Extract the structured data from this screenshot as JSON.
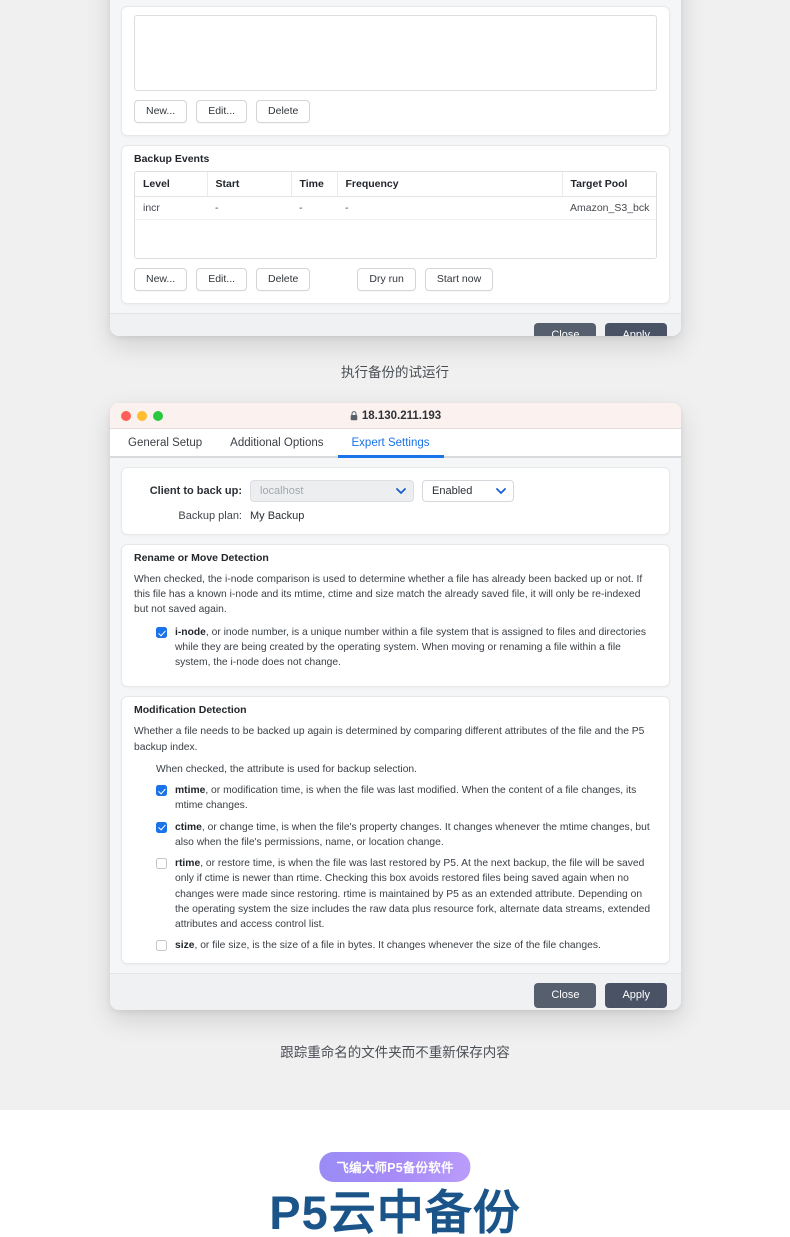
{
  "window1": {
    "top_list_buttons": [
      "New...",
      "Edit...",
      "Delete"
    ],
    "backup_events": {
      "section_title": "Backup Events",
      "columns": [
        "Level",
        "Start",
        "Time",
        "Frequency",
        "Target Pool"
      ],
      "rows": [
        {
          "level": "incr",
          "start": "-",
          "time": "-",
          "frequency": "-",
          "target_pool": "Amazon_S3_bck"
        }
      ],
      "buttons": [
        "New...",
        "Edit...",
        "Delete"
      ],
      "action_buttons": [
        "Dry run",
        "Start now"
      ]
    },
    "footer": {
      "close_label": "Close",
      "apply_label": "Apply"
    }
  },
  "caption1": "执行备份的试运行",
  "window2": {
    "titlebar": {
      "address": "18.130.211.193",
      "lock_icon": "lock-icon"
    },
    "tabs": [
      {
        "label": "General Setup",
        "active": false
      },
      {
        "label": "Additional Options",
        "active": false
      },
      {
        "label": "Expert Settings",
        "active": true
      }
    ],
    "client_card": {
      "client_label": "Client to back up:",
      "client_value": "localhost",
      "client_placeholder": "localhost",
      "enabled_value": "Enabled",
      "plan_label": "Backup plan:",
      "plan_value": "My Backup"
    },
    "rename_section": {
      "title": "Rename or Move Detection",
      "paragraph": "When checked, the i-node comparison is used to determine whether a file has already been backed up or not. If this file has a known i-node and its mtime, ctime and size match the already saved file, it will only be re-indexed but not saved again.",
      "items": [
        {
          "checked": true,
          "term": "i-node",
          "text": ", or inode number, is a unique number within a file system that is assigned to files and directories while they are being created by the operating system. When moving or renaming a file within a file system, the i-node does not change."
        }
      ]
    },
    "modification_section": {
      "title": "Modification Detection",
      "paragraph": "Whether a file needs to be backed up again is determined by comparing different attributes of the file and the P5 backup index.",
      "note": "When checked, the attribute is used for backup selection.",
      "items": [
        {
          "checked": true,
          "term": "mtime",
          "text": ", or modification time, is when the file was last modified. When the content of a file changes, its mtime changes."
        },
        {
          "checked": true,
          "term": "ctime",
          "text": ", or change time, is when the file's property changes. It changes whenever the mtime changes, but also when the file's permissions, name, or location change."
        },
        {
          "checked": false,
          "term": "rtime",
          "text": ", or restore time, is when the file was last restored by P5. At the next backup, the file will be saved only if ctime is newer than rtime. Checking this box avoids restored files being saved again when no changes were made since restoring. rtime is maintained by P5 as an extended attribute. Depending on the operating system the size includes the raw data plus resource fork, alternate data streams, extended attributes and access control list."
        },
        {
          "checked": false,
          "term": "size",
          "text": ", or file size, is the size of a file in bytes. It changes whenever the size of the file changes."
        }
      ]
    },
    "footer": {
      "close_label": "Close",
      "apply_label": "Apply"
    }
  },
  "caption2": "跟踪重命名的文件夹而不重新保存内容",
  "hero": {
    "badge": "飞编大师P5备份软件",
    "title": "P5云中备份",
    "badge_color": "#a78bf7",
    "title_color": "#1b5489"
  }
}
